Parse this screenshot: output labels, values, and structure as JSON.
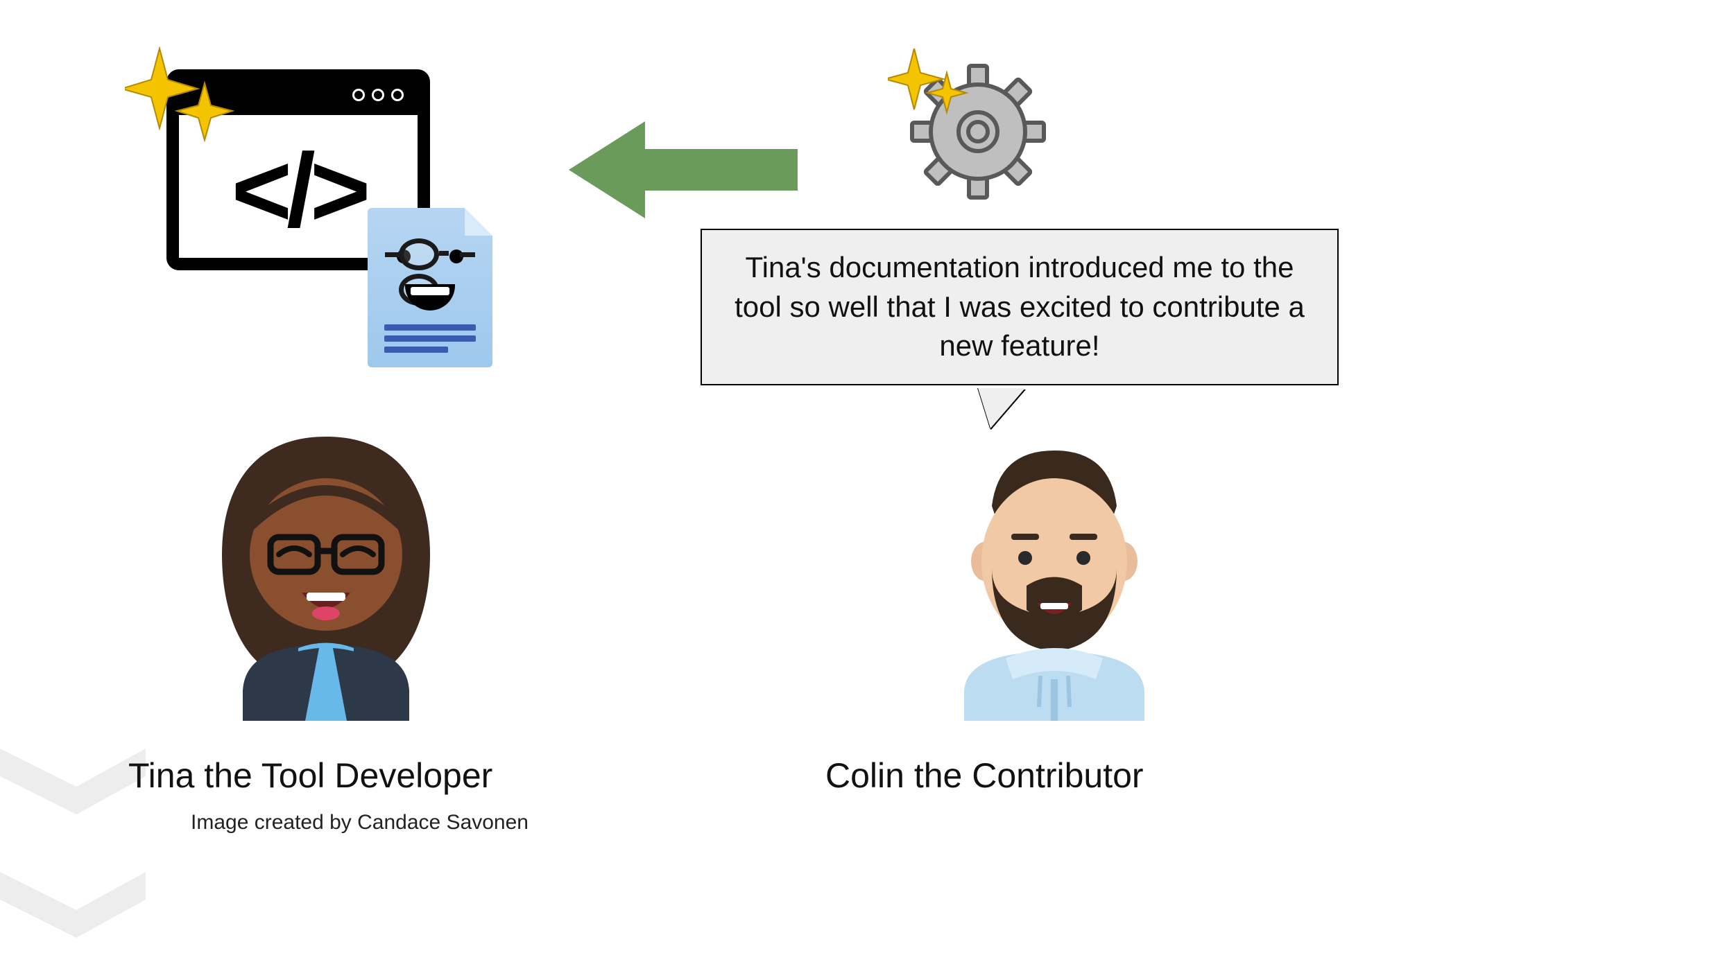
{
  "code_symbol": "</>",
  "speech_text": "Tina's documentation introduced me to the tool so well that I was excited to contribute a new feature!",
  "caption_tina": "Tina the Tool Developer",
  "caption_colin": "Colin the Contributor",
  "credit": "Image created by Candace Savonen",
  "arrow_color": "#6a9b5a",
  "gear_fill": "#bfbfbf",
  "gear_stroke": "#595959",
  "sparkle_color": "#f5c400"
}
